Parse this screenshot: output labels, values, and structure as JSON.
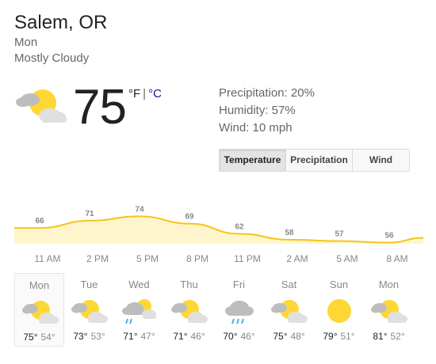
{
  "current": {
    "location": "Salem, OR",
    "day": "Mon",
    "condition": "Mostly Cloudy",
    "temperature": "75",
    "unit_f": "°F",
    "unit_sep": "|",
    "unit_c": "°C",
    "icon": "partly-cloudy-icon"
  },
  "stats": {
    "precipitation": "Precipitation: 20%",
    "humidity": "Humidity: 57%",
    "wind": "Wind: 10 mph"
  },
  "tabs": [
    {
      "label": "Temperature",
      "selected": true
    },
    {
      "label": "Precipitation",
      "selected": false
    },
    {
      "label": "Wind",
      "selected": false
    }
  ],
  "chart_data": {
    "type": "area",
    "x": [
      "11 AM",
      "2 PM",
      "5 PM",
      "8 PM",
      "11 PM",
      "2 AM",
      "5 AM",
      "8 AM"
    ],
    "values": [
      66,
      71,
      74,
      69,
      62,
      58,
      57,
      56
    ],
    "labels": [
      "66",
      "71",
      "74",
      "69",
      "62",
      "58",
      "57",
      "56"
    ],
    "tick_labels": [
      "11 AM",
      "2 PM",
      "5 PM",
      "8 PM",
      "11 PM",
      "2 AM",
      "5 AM",
      "8 AM"
    ],
    "colors": {
      "line": "#f5c518",
      "fill": "#fff5cc"
    }
  },
  "forecast": [
    {
      "day": "Mon",
      "icon": "partly-cloudy-icon",
      "hi": "75°",
      "lo": "54°",
      "selected": true
    },
    {
      "day": "Tue",
      "icon": "partly-cloudy-icon",
      "hi": "73°",
      "lo": "53°"
    },
    {
      "day": "Wed",
      "icon": "rain-sun-icon",
      "hi": "71°",
      "lo": "47°"
    },
    {
      "day": "Thu",
      "icon": "partly-cloudy-icon",
      "hi": "71°",
      "lo": "46°"
    },
    {
      "day": "Fri",
      "icon": "rain-icon",
      "hi": "70°",
      "lo": "46°"
    },
    {
      "day": "Sat",
      "icon": "partly-cloudy-icon",
      "hi": "75°",
      "lo": "48°"
    },
    {
      "day": "Sun",
      "icon": "sunny-icon",
      "hi": "79°",
      "lo": "51°"
    },
    {
      "day": "Mon",
      "icon": "partly-cloudy-icon",
      "hi": "81°",
      "lo": "52°"
    }
  ]
}
